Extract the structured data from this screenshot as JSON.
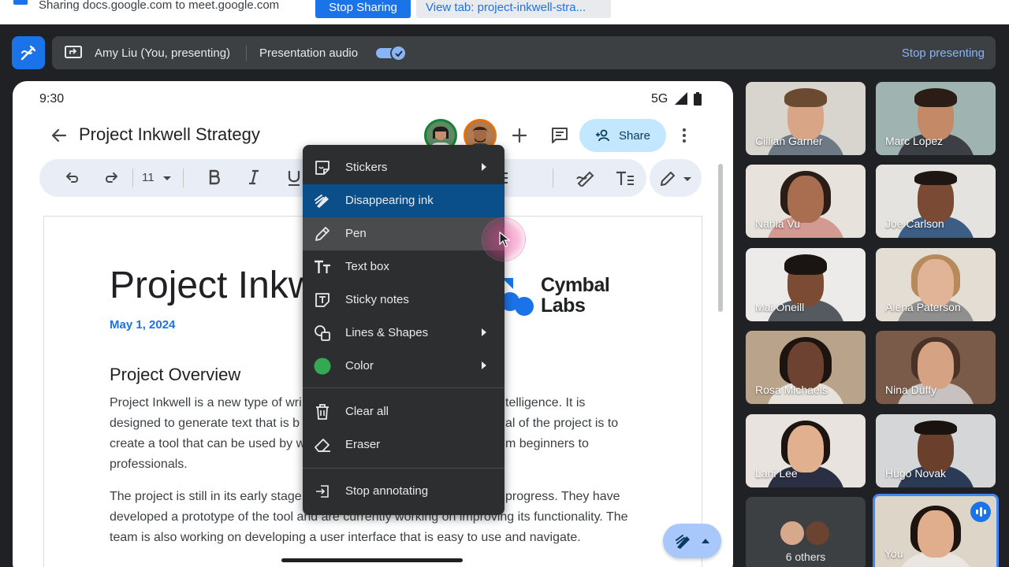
{
  "share_banner": {
    "text": "Sharing docs.google.com to meet.google.com",
    "stop_label": "Stop Sharing",
    "view_tab_label": "View tab: project-inkwell-stra..."
  },
  "meet_bar": {
    "presenter": "Amy Liu (You, presenting)",
    "audio_label": "Presentation audio",
    "audio_enabled": true,
    "stop_label": "Stop presenting",
    "accent_color": "#1a73e8"
  },
  "phone": {
    "time": "9:30",
    "network": "5G"
  },
  "doc": {
    "title": "Project Inkwell Strategy",
    "share_label": "Share",
    "font_size": "11",
    "heading_visible": "Project Inkw",
    "date": "May 1, 2024",
    "logo_text_1": "Cymbal",
    "logo_text_2": "Labs",
    "section_title": "Project Overview",
    "para1_line1_a": "Project Inkwell is a new type of wri",
    "para1_line1_b": "telligence. It is",
    "para1_line2_a": "designed to generate text that is b",
    "para1_line2_b": "al of the project is to",
    "para1_line3_a": "create a tool that can be used by w",
    "para1_line3_b": "m beginners to",
    "para1_line4": "professionals.",
    "para2_line1_a": "The project is still in its early stage",
    "para2_line1_b": "progress. They have",
    "para2_line2": "developed a prototype of the tool and are currently working on improving its functionality. The",
    "para2_line3": "team is also working on developing a user interface that is easy to use and navigate."
  },
  "menu": {
    "items": [
      {
        "label": "Stickers",
        "icon": "sticker-icon",
        "submenu": true
      },
      {
        "label": "Disappearing ink",
        "icon": "disappearing-ink-icon",
        "submenu": false
      },
      {
        "label": "Pen",
        "icon": "pen-icon",
        "submenu": false
      },
      {
        "label": "Text box",
        "icon": "text-box-icon",
        "submenu": false
      },
      {
        "label": "Sticky notes",
        "icon": "sticky-note-icon",
        "submenu": false
      },
      {
        "label": "Lines & Shapes",
        "icon": "shapes-icon",
        "submenu": true
      },
      {
        "label": "Color",
        "icon": "color-swatch-icon",
        "submenu": true
      },
      {
        "label": "Clear all",
        "icon": "trash-icon",
        "submenu": false
      },
      {
        "label": "Eraser",
        "icon": "eraser-icon",
        "submenu": false
      },
      {
        "label": "Stop annotating",
        "icon": "exit-icon",
        "submenu": false
      }
    ],
    "selected": "Disappearing ink",
    "hovered": "Pen",
    "color_value": "#34a853"
  },
  "participants": {
    "tiles": [
      {
        "name": "Cillian Garner"
      },
      {
        "name": "Marc Lopez"
      },
      {
        "name": "Nahla Vu"
      },
      {
        "name": "Joe Carlson"
      },
      {
        "name": "Mai Oneill"
      },
      {
        "name": "Alena Paterson"
      },
      {
        "name": "Rosa Michaels"
      },
      {
        "name": "Nina Duffy"
      },
      {
        "name": "Lani Lee"
      },
      {
        "name": "Hugo Novak"
      }
    ],
    "others_label": "6 others",
    "self_label": "You"
  }
}
